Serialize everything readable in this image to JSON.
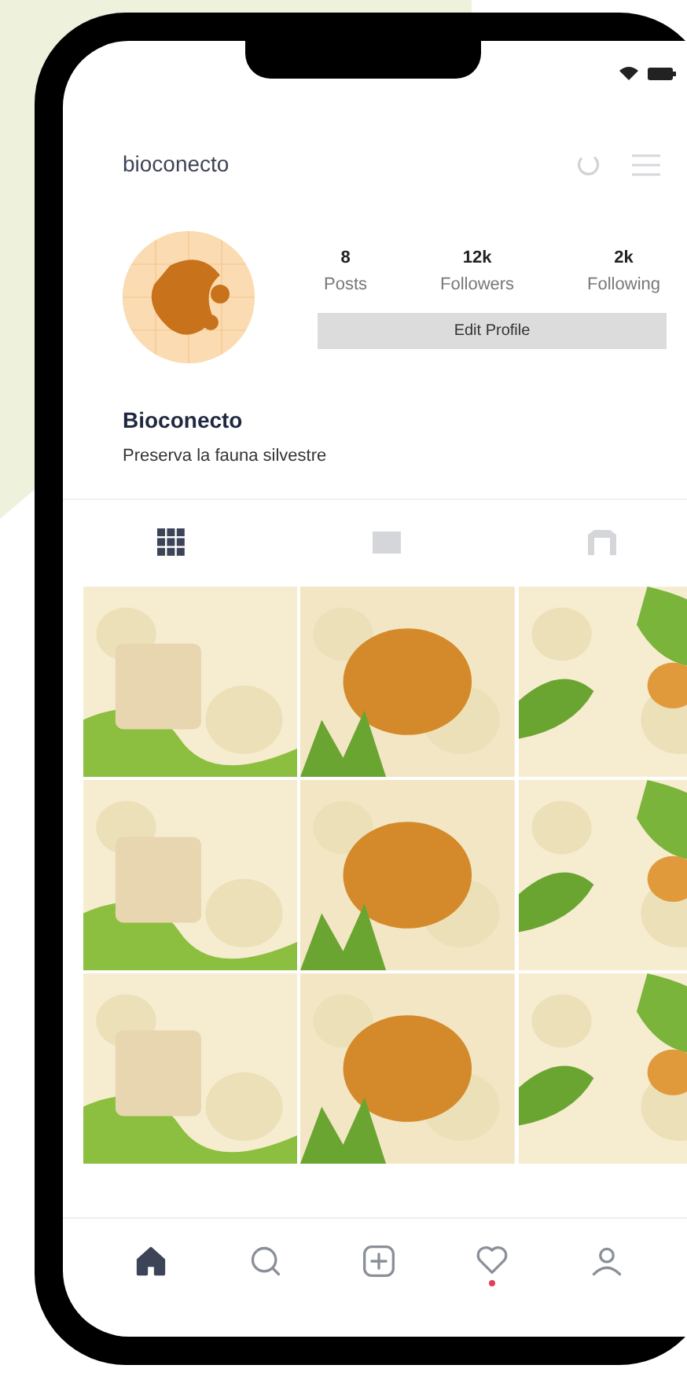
{
  "header": {
    "username": "bioconecto"
  },
  "profile": {
    "stats": [
      {
        "value": "8",
        "label": "Posts"
      },
      {
        "value": "12k",
        "label": "Followers"
      },
      {
        "value": "2k",
        "label": "Following"
      }
    ],
    "edit_button": "Edit Profile",
    "name": "Bioconecto",
    "bio": "Preserva la fauna silvestre"
  },
  "tabs": [
    {
      "kind": "grid",
      "selected": true
    },
    {
      "kind": "feed",
      "selected": false
    },
    {
      "kind": "tagged",
      "selected": false
    }
  ],
  "nav": [
    {
      "kind": "home",
      "selected": true,
      "notification": false
    },
    {
      "kind": "search",
      "selected": false,
      "notification": false
    },
    {
      "kind": "add",
      "selected": false,
      "notification": false
    },
    {
      "kind": "activity",
      "selected": false,
      "notification": true
    },
    {
      "kind": "profile",
      "selected": false,
      "notification": false
    }
  ]
}
